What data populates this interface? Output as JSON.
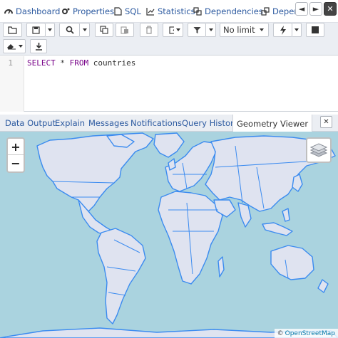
{
  "top_tabs": [
    {
      "label": "Dashboard",
      "icon": "dashboard-icon"
    },
    {
      "label": "Properties",
      "icon": "cogs-icon"
    },
    {
      "label": "SQL",
      "icon": "file-icon"
    },
    {
      "label": "Statistics",
      "icon": "chart-icon"
    },
    {
      "label": "Dependencies",
      "icon": "dependencies-icon"
    },
    {
      "label": "Depend",
      "icon": "dependents-icon"
    }
  ],
  "nav": {
    "prev": "◄",
    "next": "►",
    "close": "✕"
  },
  "toolbar": {
    "limit_value": "No limit"
  },
  "editor": {
    "line_number": "1",
    "kw_select": "SELECT",
    "star": " * ",
    "kw_from": "FROM",
    "table": " countries"
  },
  "result_tabs": [
    "Data Output",
    "Explain",
    "Messages",
    "Notifications",
    "Query History",
    "Geometry Viewer"
  ],
  "active_result_tab": "Geometry Viewer",
  "result_close": "✕",
  "map": {
    "zoom_in": "+",
    "zoom_out": "−",
    "attribution_prefix": "©",
    "attribution_link": "OpenStreetMap",
    "ocean_color": "#aad3df",
    "land_color": "#dfe3f0",
    "border_color": "#3b8bf0"
  },
  "colors": {
    "link": "#2c5aa0",
    "toolbar_bg": "#ebeef3",
    "keyword": "#770088"
  }
}
